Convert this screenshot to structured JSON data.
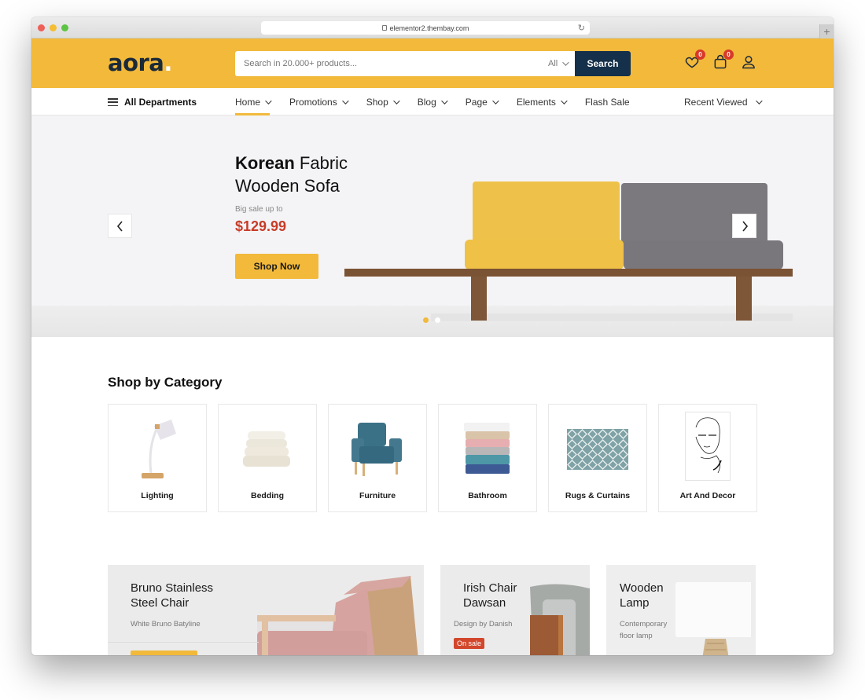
{
  "browser": {
    "url": "elementor2.thembay.com",
    "new_tab_label": "+"
  },
  "header": {
    "logo_text": "aora",
    "logo_dot": ".",
    "search_placeholder": "Search in 20.000+ products...",
    "search_category": "All",
    "search_button": "Search",
    "wishlist_count": "0",
    "cart_count": "0",
    "colors": {
      "brand_yellow": "#f2b93b",
      "navy": "#15304a",
      "badge_red": "#d83a2a"
    }
  },
  "nav": {
    "departments_label": "All Departments",
    "links": [
      {
        "label": "Home",
        "dropdown": true,
        "active": true
      },
      {
        "label": "Promotions",
        "dropdown": true
      },
      {
        "label": "Shop",
        "dropdown": true
      },
      {
        "label": "Blog",
        "dropdown": true
      },
      {
        "label": "Page",
        "dropdown": true
      },
      {
        "label": "Elements",
        "dropdown": true
      },
      {
        "label": "Flash Sale",
        "dropdown": false
      }
    ],
    "recent_viewed": "Recent Viewed"
  },
  "hero": {
    "title_bold": "Korean",
    "title_rest_line1": "Fabric",
    "title_line2": "Wooden Sofa",
    "subtitle": "Big sale up to",
    "price": "$129.99",
    "cta": "Shop Now",
    "slides_total": 2,
    "active_slide": 1,
    "price_color": "#c83b27"
  },
  "categories": {
    "title": "Shop by Category",
    "items": [
      {
        "label": "Lighting",
        "icon": "desk-lamp-image"
      },
      {
        "label": "Bedding",
        "icon": "pillows-image"
      },
      {
        "label": "Furniture",
        "icon": "armchair-image"
      },
      {
        "label": "Bathroom",
        "icon": "towels-image"
      },
      {
        "label": "Rugs & Curtains",
        "icon": "rug-image"
      },
      {
        "label": "Art And Decor",
        "icon": "line-art-portrait-image"
      }
    ]
  },
  "promos": [
    {
      "title_line1": "Bruno Stainless",
      "title_line2": "Steel Chair",
      "subtitle": "White Bruno Batyline"
    },
    {
      "title_line1": "Irish Chair",
      "title_line2": "Dawsan",
      "subtitle": "Design by Danish",
      "tag": "On sale"
    },
    {
      "title_line1": "Wooden",
      "title_line2": "Lamp",
      "subtitle_line1": "Contemporary",
      "subtitle_line2": "floor lamp"
    }
  ]
}
